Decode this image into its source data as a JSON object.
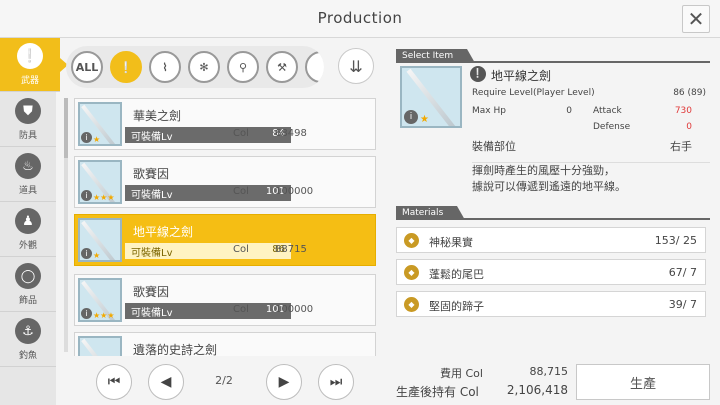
{
  "window": {
    "title": "Production",
    "close_glyph": "✕"
  },
  "sidebar": {
    "items": [
      {
        "label": "武器",
        "icon": "sword-icon",
        "glyph": "❕",
        "active": true
      },
      {
        "label": "防具",
        "icon": "armor-icon",
        "glyph": "⛊",
        "active": false
      },
      {
        "label": "道具",
        "icon": "potion-icon",
        "glyph": "♨",
        "active": false
      },
      {
        "label": "外觀",
        "icon": "costume-icon",
        "glyph": "♟",
        "active": false
      },
      {
        "label": "飾品",
        "icon": "ring-icon",
        "glyph": "◯",
        "active": false
      },
      {
        "label": "釣魚",
        "icon": "fishing-icon",
        "glyph": "⚓",
        "active": false
      }
    ]
  },
  "filters": [
    {
      "label": "ALL",
      "icon": "all-filter-icon",
      "active": false
    },
    {
      "label": "❕",
      "icon": "sword-filter-icon",
      "active": true
    },
    {
      "label": "⌇",
      "icon": "rapier-filter-icon",
      "active": false
    },
    {
      "label": "✻",
      "icon": "mace-filter-icon",
      "active": false
    },
    {
      "label": "⚲",
      "icon": "dagger-filter-icon",
      "active": false
    },
    {
      "label": "⚒",
      "icon": "axe-filter-icon",
      "active": false
    },
    {
      "label": "",
      "icon": "spear-filter-icon",
      "active": false
    }
  ],
  "sort_glyph": "⇊",
  "list": {
    "req_label": "可裝備Lv",
    "col_label": "Col",
    "items": [
      {
        "name": "華美之劍",
        "stars": "★",
        "level": "84",
        "col": "68498",
        "selected": false
      },
      {
        "name": "歌賽因",
        "stars": "★★★",
        "level": "101",
        "col": "100000",
        "selected": false
      },
      {
        "name": "地平線之劍",
        "stars": "★",
        "level": "86",
        "col": "88715",
        "selected": true
      },
      {
        "name": "歌賽因",
        "stars": "★★★",
        "level": "101",
        "col": "100000",
        "selected": false
      },
      {
        "name": "遺落的史詩之劍",
        "stars": "★",
        "level": "",
        "col": "",
        "selected": false
      }
    ]
  },
  "pager": {
    "first": "⏮",
    "prev": "◀",
    "next": "▶",
    "last": "⏭",
    "page": "2/2"
  },
  "detail": {
    "section_label": "Select Item",
    "name": "地平線之劍",
    "stars": "★",
    "require_label": "Require Level(Player Level)",
    "require_value": "86 (89)",
    "maxhp_label": "Max Hp",
    "maxhp_value": "0",
    "attack_label": "Attack",
    "attack_value": "730",
    "defense_label": "Defense",
    "defense_value": "0",
    "slot_label": "裝備部位",
    "slot_value": "右手",
    "description_1": "揮劍時產生的風壓十分強勁，",
    "description_2": "據說可以傳遞到遙遠的地平線。"
  },
  "materials": {
    "section_label": "Materials",
    "items": [
      {
        "name": "神秘果實",
        "count": "153/ 25"
      },
      {
        "name": "蓬鬆的尾巴",
        "count": "67/ 7"
      },
      {
        "name": "堅固的蹄子",
        "count": "39/ 7"
      }
    ]
  },
  "cost": {
    "fee_label": "費用 Col",
    "fee_value": "88,715",
    "after_label": "生產後持有 Col",
    "after_value": "2,106,418",
    "produce_label": "生產"
  },
  "colors": {
    "accent": "#f2be1a",
    "attack_red": "#e03a3a",
    "dark_tag": "#666666"
  }
}
